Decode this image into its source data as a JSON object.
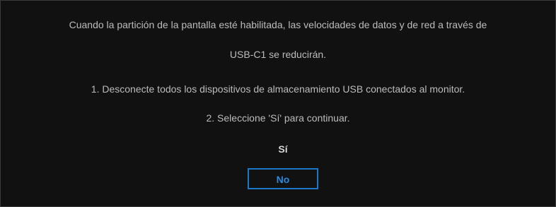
{
  "dialog": {
    "message_line1": "Cuando la partición de la pantalla esté habilitada, las velocidades de datos y de red a través de",
    "message_line2": "USB-C1 se reducirán.",
    "instruction1": "1. Desconecte todos los dispositivos de almacenamiento USB conectados al monitor.",
    "instruction2": "2. Seleccione 'Sí' para continuar.",
    "yes_label": "Sí",
    "no_label": "No",
    "selected_option": "No"
  },
  "colors": {
    "background": "#111111",
    "text": "#bcbcbc",
    "accent": "#1b78c8"
  }
}
